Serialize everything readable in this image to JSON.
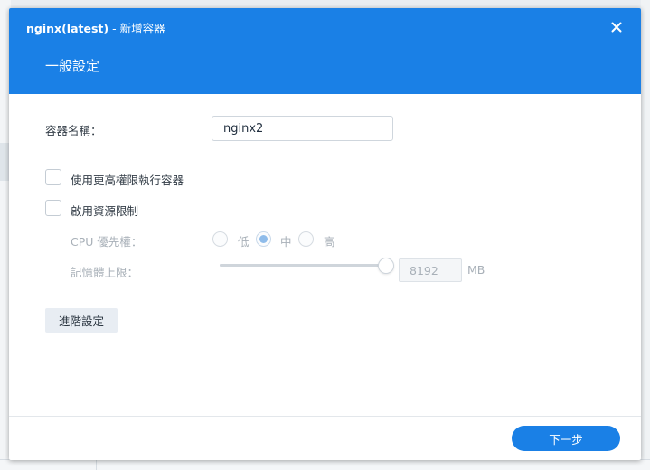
{
  "dialog": {
    "app_name": "nginx(latest)",
    "separator": "-",
    "title": "新增容器",
    "section_title": "一般設定",
    "close_icon": "close-icon"
  },
  "form": {
    "container_name_label": "容器名稱：",
    "container_name_value": "nginx2",
    "privileged_label": "使用更高權限執行容器",
    "privileged_checked": false,
    "resource_limit_label": "啟用資源限制",
    "resource_limit_checked": false,
    "cpu_priority_label": "CPU 優先權：",
    "cpu_options": [
      "低",
      "中",
      "高"
    ],
    "cpu_selected": "中",
    "memory_label": "記憶體上限：",
    "memory_value": "8192",
    "memory_unit": "MB",
    "memory_slider_fraction": 1.0
  },
  "buttons": {
    "advanced": "進階設定",
    "next": "下一步"
  },
  "colors": {
    "accent": "#1a80e6",
    "disabled_text": "#a8b0b8"
  }
}
